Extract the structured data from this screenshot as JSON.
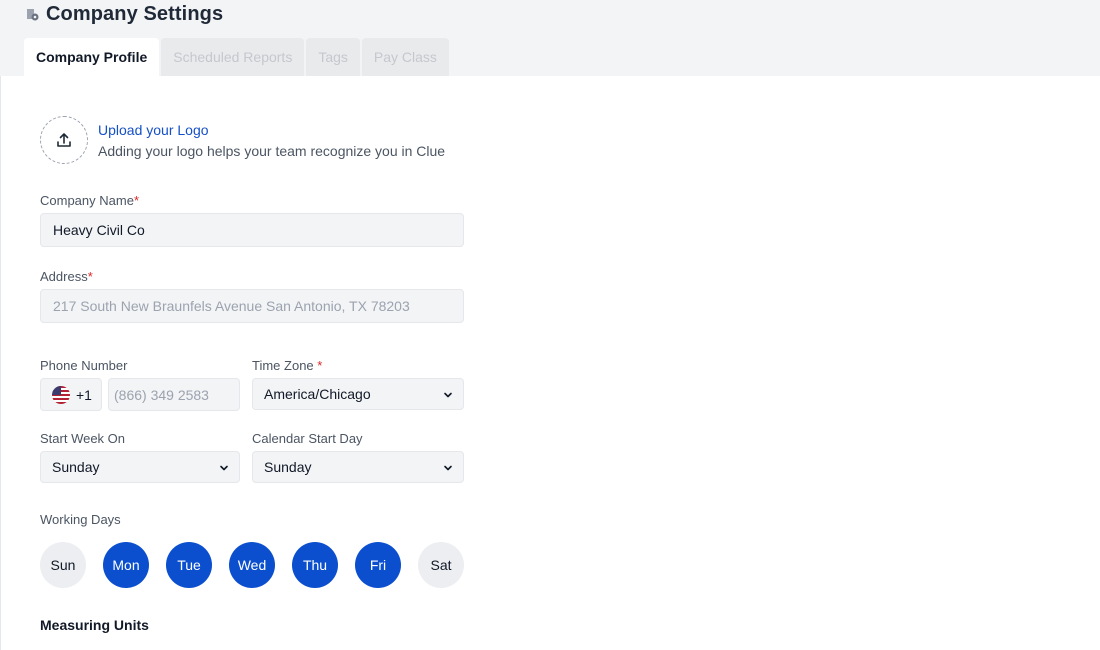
{
  "header": {
    "title": "Company Settings",
    "tabs": [
      {
        "label": "Company Profile",
        "active": true
      },
      {
        "label": "Scheduled Reports",
        "active": false
      },
      {
        "label": "Tags",
        "active": false
      },
      {
        "label": "Pay Class",
        "active": false
      }
    ]
  },
  "logo": {
    "upload_label": "Upload your Logo",
    "description": "Adding your logo helps your team recognize you in Clue",
    "icon": "upload-icon"
  },
  "form": {
    "company_name": {
      "label": "Company Name",
      "required_mark": "*",
      "value": "Heavy Civil Co"
    },
    "address": {
      "label": "Address",
      "required_mark": "*",
      "placeholder": "217 South New Braunfels Avenue San Antonio, TX 78203"
    },
    "phone": {
      "label": "Phone Number",
      "country_code": "+1",
      "flag": "us-flag-icon",
      "placeholder": "(866) 349 2583"
    },
    "time_zone": {
      "label": "Time Zone",
      "required_mark": "*",
      "value": "America/Chicago"
    },
    "start_week_on": {
      "label": "Start Week On",
      "value": "Sunday"
    },
    "calendar_start_day": {
      "label": "Calendar Start Day",
      "value": "Sunday"
    },
    "working_days": {
      "label": "Working Days",
      "days": [
        {
          "label": "Sun",
          "selected": false
        },
        {
          "label": "Mon",
          "selected": true
        },
        {
          "label": "Tue",
          "selected": true
        },
        {
          "label": "Wed",
          "selected": true
        },
        {
          "label": "Thu",
          "selected": true
        },
        {
          "label": "Fri",
          "selected": true
        },
        {
          "label": "Sat",
          "selected": false
        }
      ]
    },
    "measuring_units": {
      "label": "Measuring Units"
    }
  },
  "colors": {
    "accent": "#0b4fce",
    "link": "#1550c7",
    "required": "#dc2626",
    "header_bg": "#f3f4f6"
  }
}
